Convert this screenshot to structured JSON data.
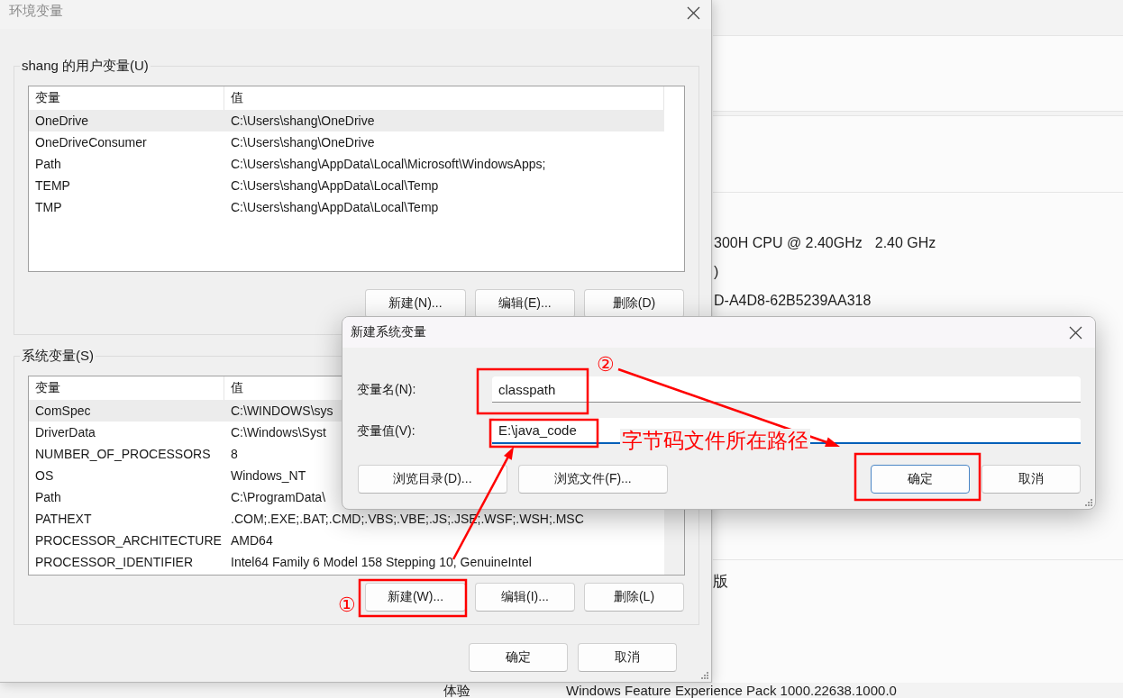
{
  "settings_page": {
    "spec_lines": [
      [
        "300H CPU @ 2.40GHz",
        "2.40 GHz"
      ],
      [
        ")"
      ],
      [
        "D-A4D8-62B5239AA318"
      ]
    ],
    "edition_fragment": "版",
    "experience_row": {
      "label": "体验",
      "value": "Windows Feature Experience Pack 1000.22638.1000.0"
    }
  },
  "env_dialog": {
    "title": "环境变量",
    "groups": [
      {
        "label": "shang 的用户变量(U)",
        "scrollbar": false,
        "columns": [
          "变量",
          "值"
        ],
        "rows": [
          {
            "name": "OneDrive",
            "value": "C:\\Users\\shang\\OneDrive",
            "selected": true
          },
          {
            "name": "OneDriveConsumer",
            "value": "C:\\Users\\shang\\OneDrive",
            "selected": false
          },
          {
            "name": "Path",
            "value": "C:\\Users\\shang\\AppData\\Local\\Microsoft\\WindowsApps;",
            "selected": false
          },
          {
            "name": "TEMP",
            "value": "C:\\Users\\shang\\AppData\\Local\\Temp",
            "selected": false
          },
          {
            "name": "TMP",
            "value": "C:\\Users\\shang\\AppData\\Local\\Temp",
            "selected": false
          }
        ],
        "buttons": [
          "新建(N)...",
          "编辑(E)...",
          "删除(D)"
        ]
      },
      {
        "label": "系统变量(S)",
        "scrollbar": true,
        "columns": [
          "变量",
          "值"
        ],
        "rows": [
          {
            "name": "ComSpec",
            "value": "C:\\WINDOWS\\sys",
            "selected": true
          },
          {
            "name": "DriverData",
            "value": "C:\\Windows\\Syst",
            "selected": false
          },
          {
            "name": "NUMBER_OF_PROCESSORS",
            "value": "8",
            "selected": false
          },
          {
            "name": "OS",
            "value": "Windows_NT",
            "selected": false
          },
          {
            "name": "Path",
            "value": "C:\\ProgramData\\",
            "selected": false
          },
          {
            "name": "PATHEXT",
            "value": ".COM;.EXE;.BAT;.CMD;.VBS;.VBE;.JS;.JSE;.WSF;.WSH;.MSC",
            "selected": false
          },
          {
            "name": "PROCESSOR_ARCHITECTURE",
            "value": "AMD64",
            "selected": false
          },
          {
            "name": "PROCESSOR_IDENTIFIER",
            "value": "Intel64 Family 6 Model 158 Stepping 10, GenuineIntel",
            "selected": false
          }
        ],
        "buttons": [
          "新建(W)...",
          "编辑(I)...",
          "删除(L)"
        ]
      }
    ],
    "buttons": [
      "确定",
      "取消"
    ]
  },
  "new_var_dialog": {
    "title": "新建系统变量",
    "fields": [
      {
        "label": "变量名(N):",
        "value": "classpath",
        "focused": false
      },
      {
        "label": "变量值(V):",
        "value": "E:\\java_code",
        "focused": true
      }
    ],
    "browse_buttons": [
      "浏览目录(D)...",
      "浏览文件(F)..."
    ],
    "action_buttons": [
      {
        "label": "确定",
        "default": true
      },
      {
        "label": "取消",
        "default": false
      }
    ]
  },
  "annotations": {
    "step_marks": [
      "①",
      "②"
    ],
    "note": "字节码文件所在路径"
  }
}
